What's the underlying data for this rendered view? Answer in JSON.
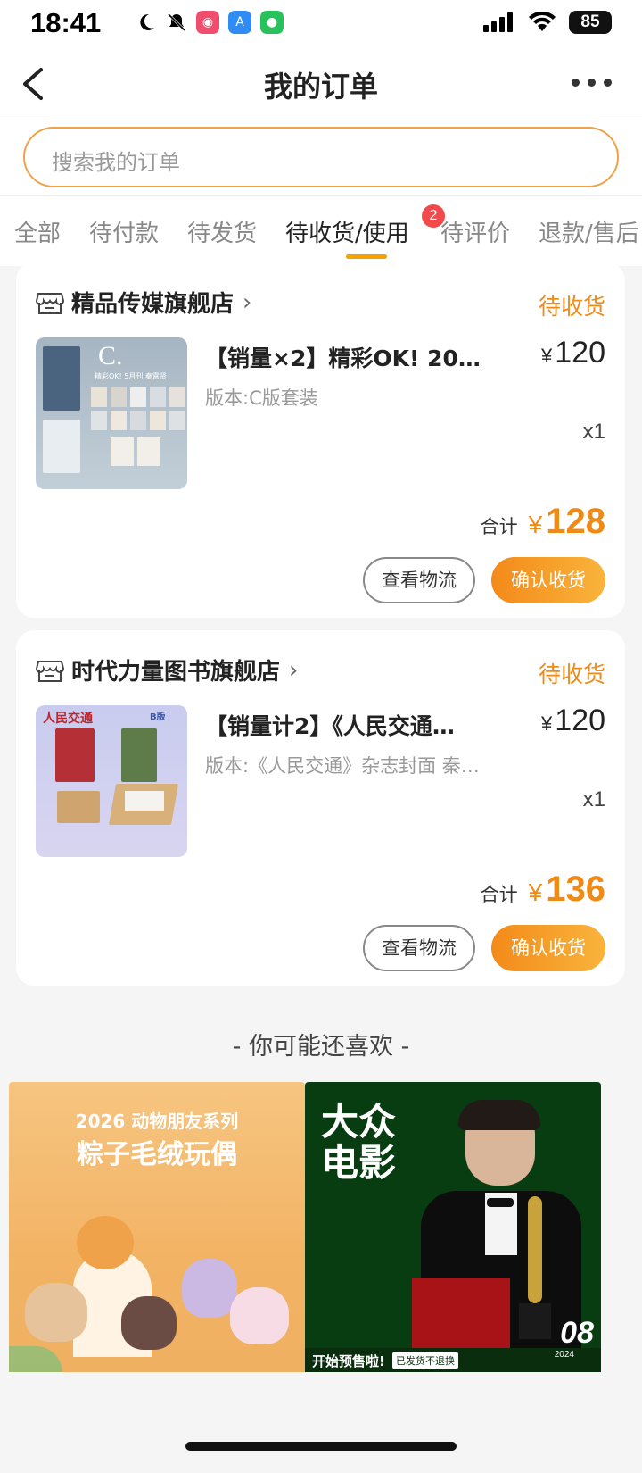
{
  "status": {
    "time": "18:41",
    "battery": "85"
  },
  "nav": {
    "title": "我的订单"
  },
  "search": {
    "placeholder": "搜索我的订单"
  },
  "tabs": [
    {
      "label": "全部"
    },
    {
      "label": "待付款"
    },
    {
      "label": "待发货"
    },
    {
      "label": "待收货/使用",
      "badge": "2",
      "active": true
    },
    {
      "label": "待评价"
    },
    {
      "label": "退款/售后"
    }
  ],
  "orders": [
    {
      "shop": "精品传媒旗舰店",
      "status": "待收货",
      "title": "【销量×2】精彩OK! 20…",
      "spec": "版本:C版套装",
      "currency": "¥",
      "price": "120",
      "qty": "x1",
      "total_label": "合计",
      "total": "128",
      "btn_logistics": "查看物流",
      "btn_confirm": "确认收货",
      "thumb_text": "C.",
      "thumb_sub": "精彩OK! 5月刊 秦霄贤"
    },
    {
      "shop": "时代力量图书旗舰店",
      "status": "待收货",
      "title": "【销量计2】《人民交通…",
      "spec": "版本:《人民交通》杂志封面 秦…",
      "currency": "¥",
      "price": "120",
      "qty": "x1",
      "total_label": "合计",
      "total": "136",
      "btn_logistics": "查看物流",
      "btn_confirm": "确认收货",
      "thumb_text": "人民交通",
      "thumb_sub": "B版"
    }
  ],
  "recommend": {
    "header": "- 你可能还喜欢 -",
    "left_line1": "2026 动物朋友系列",
    "left_line2": "粽子毛绒玩偶",
    "right_title": "大众电影",
    "right_banner": "开始预售啦!",
    "right_tag": "已发货不退换",
    "right_num": "08",
    "right_year": "2024"
  }
}
